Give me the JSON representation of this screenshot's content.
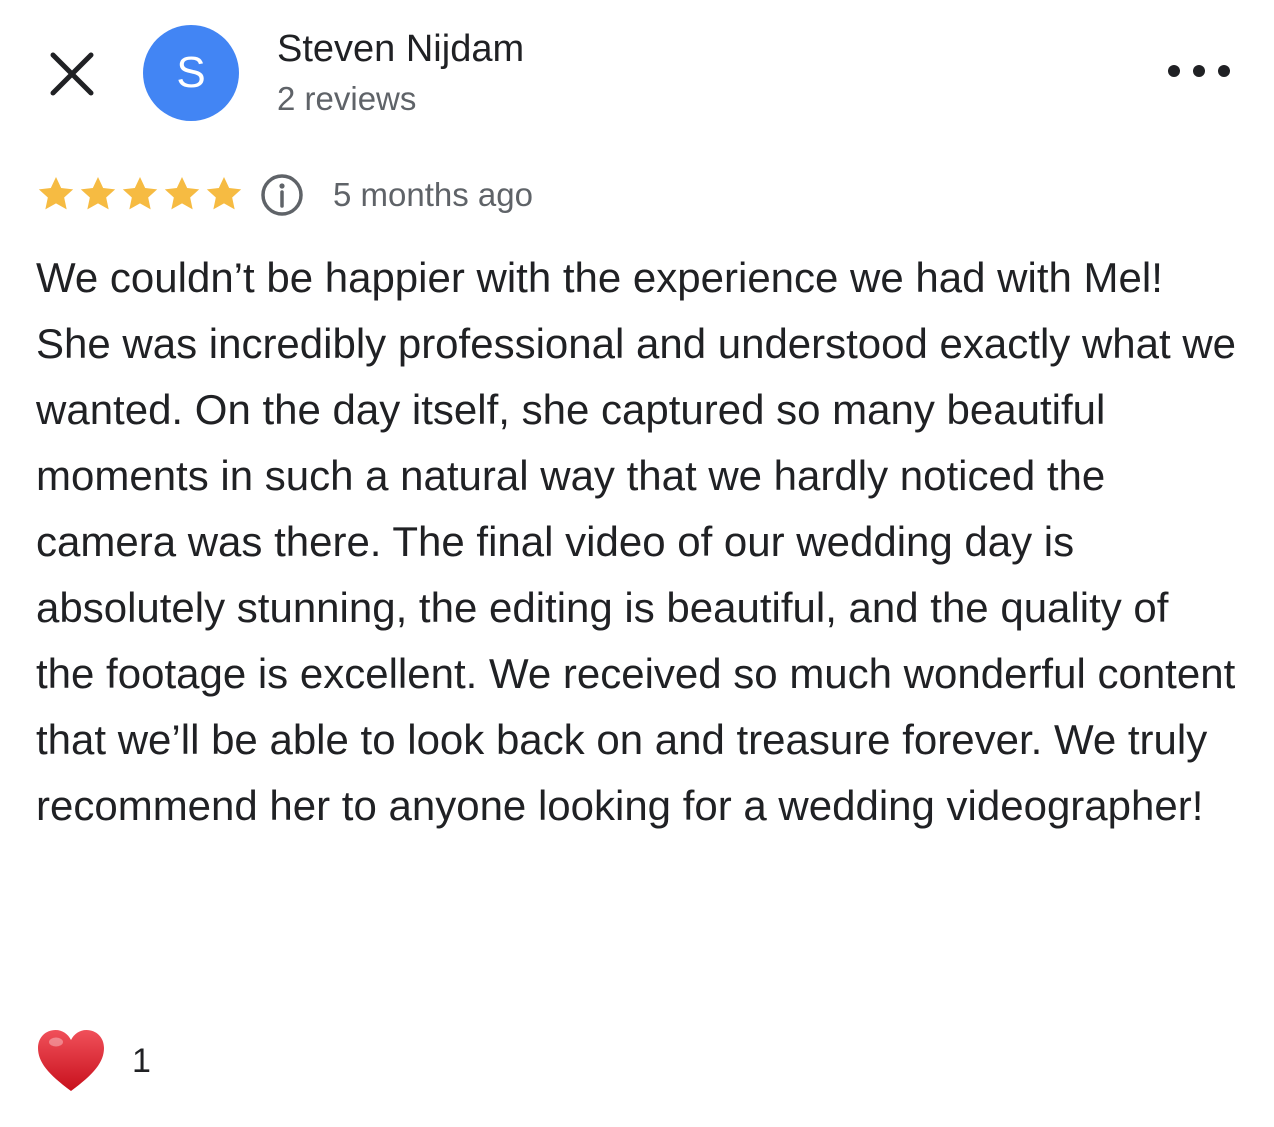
{
  "header": {
    "avatar_letter": "S",
    "avatar_color": "#4285f4",
    "reviewer_name": "Steven Nijdam",
    "reviewer_stats": "2 reviews",
    "close_icon": "close-icon",
    "more_icon": "more-horizontal-icon"
  },
  "review": {
    "rating": 5,
    "rating_max": 5,
    "star_color": "#f6bb42",
    "info_icon": "info-icon",
    "date": "5 months ago",
    "text": "We couldn’t be happier with the experience we had with Mel! She was incredibly professional and understood exactly what we wanted. On the day itself, she captured so many beautiful moments in such a natural way that we hardly noticed the camera was there. The final video of our wedding day is absolutely stunning, the editing is beautiful, and the quality of the footage is excellent. We received so much wonderful content that we’ll be able to look back on and treasure forever. We truly recommend her to anyone looking for a wedding videographer!"
  },
  "reactions": {
    "icon": "heart-icon",
    "heart_color": "#e0232e",
    "count": "1"
  }
}
